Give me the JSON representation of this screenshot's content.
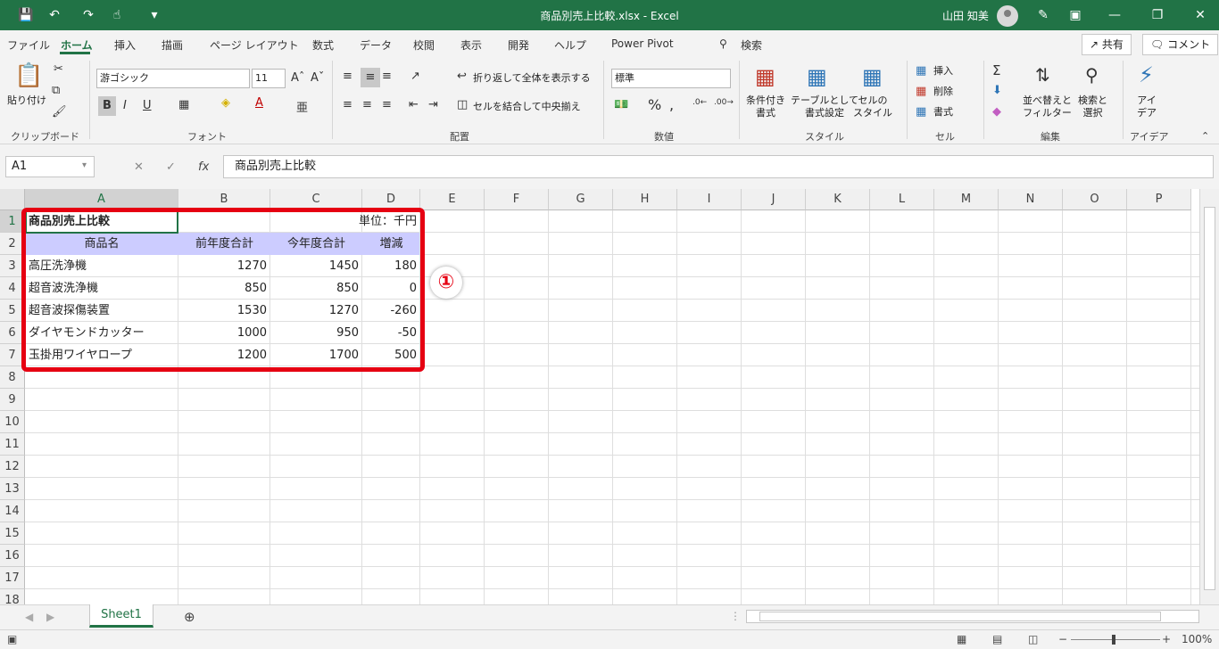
{
  "titlebar": {
    "title": "商品別売上比較.xlsx  -  Excel",
    "user": "山田 知美"
  },
  "menu": {
    "items": [
      "ファイル",
      "ホーム",
      "挿入",
      "描画",
      "ページ レイアウト",
      "数式",
      "データ",
      "校閲",
      "表示",
      "開発",
      "ヘルプ",
      "Power Pivot"
    ],
    "search_label": "検索",
    "share_label": "共有",
    "comment_label": "コメント"
  },
  "ribbon": {
    "clipboard": {
      "paste": "貼り付け",
      "label": "クリップボード"
    },
    "font": {
      "name": "游ゴシック",
      "size": "11",
      "label": "フォント"
    },
    "alignment": {
      "wrap": "折り返して全体を表示する",
      "merge": "セルを結合して中央揃え",
      "label": "配置"
    },
    "number": {
      "format": "標準",
      "label": "数値"
    },
    "styles": {
      "conditional": "条件付き\n書式",
      "as_table": "テーブルとして\n書式設定",
      "cell_style": "セルの\nスタイル",
      "label": "スタイル"
    },
    "cells": {
      "insert": "挿入",
      "delete": "削除",
      "format": "書式",
      "label": "セル"
    },
    "editing": {
      "sort": "並べ替えと\nフィルター",
      "find": "検索と\n選択",
      "label": "編集"
    },
    "ideas": {
      "btn": "アイ\nデア",
      "label": "アイデア"
    }
  },
  "formula_bar": {
    "name_box": "A1",
    "fx": "fx",
    "content": "商品別売上比較"
  },
  "columns": [
    "A",
    "B",
    "C",
    "D",
    "E",
    "F",
    "G",
    "H",
    "I",
    "J",
    "K",
    "L",
    "M",
    "N",
    "O",
    "P"
  ],
  "rows": [
    "1",
    "2",
    "3",
    "4",
    "5",
    "6",
    "7",
    "8",
    "9",
    "10",
    "11",
    "12",
    "13",
    "14",
    "15",
    "16",
    "17",
    "18"
  ],
  "table": {
    "title": "商品別売上比較",
    "unit": "単位：千円",
    "headers": [
      "商品名",
      "前年度合計",
      "今年度合計",
      "増減"
    ],
    "rows": [
      [
        "高圧洗浄機",
        "1270",
        "1450",
        "180"
      ],
      [
        "超音波洗浄機",
        "850",
        "850",
        "0"
      ],
      [
        "超音波探傷装置",
        "1530",
        "1270",
        "-260"
      ],
      [
        "ダイヤモンドカッター",
        "1000",
        "950",
        "-50"
      ],
      [
        "玉掛用ワイヤロープ",
        "1200",
        "1700",
        "500"
      ]
    ]
  },
  "annotation": {
    "marker": "①",
    "color": "#e60012"
  },
  "sheet_tabs": {
    "active": "Sheet1"
  },
  "status": {
    "zoom": "100%"
  },
  "colors": {
    "excel_green": "#217346",
    "header_fill": "#ccccff"
  }
}
